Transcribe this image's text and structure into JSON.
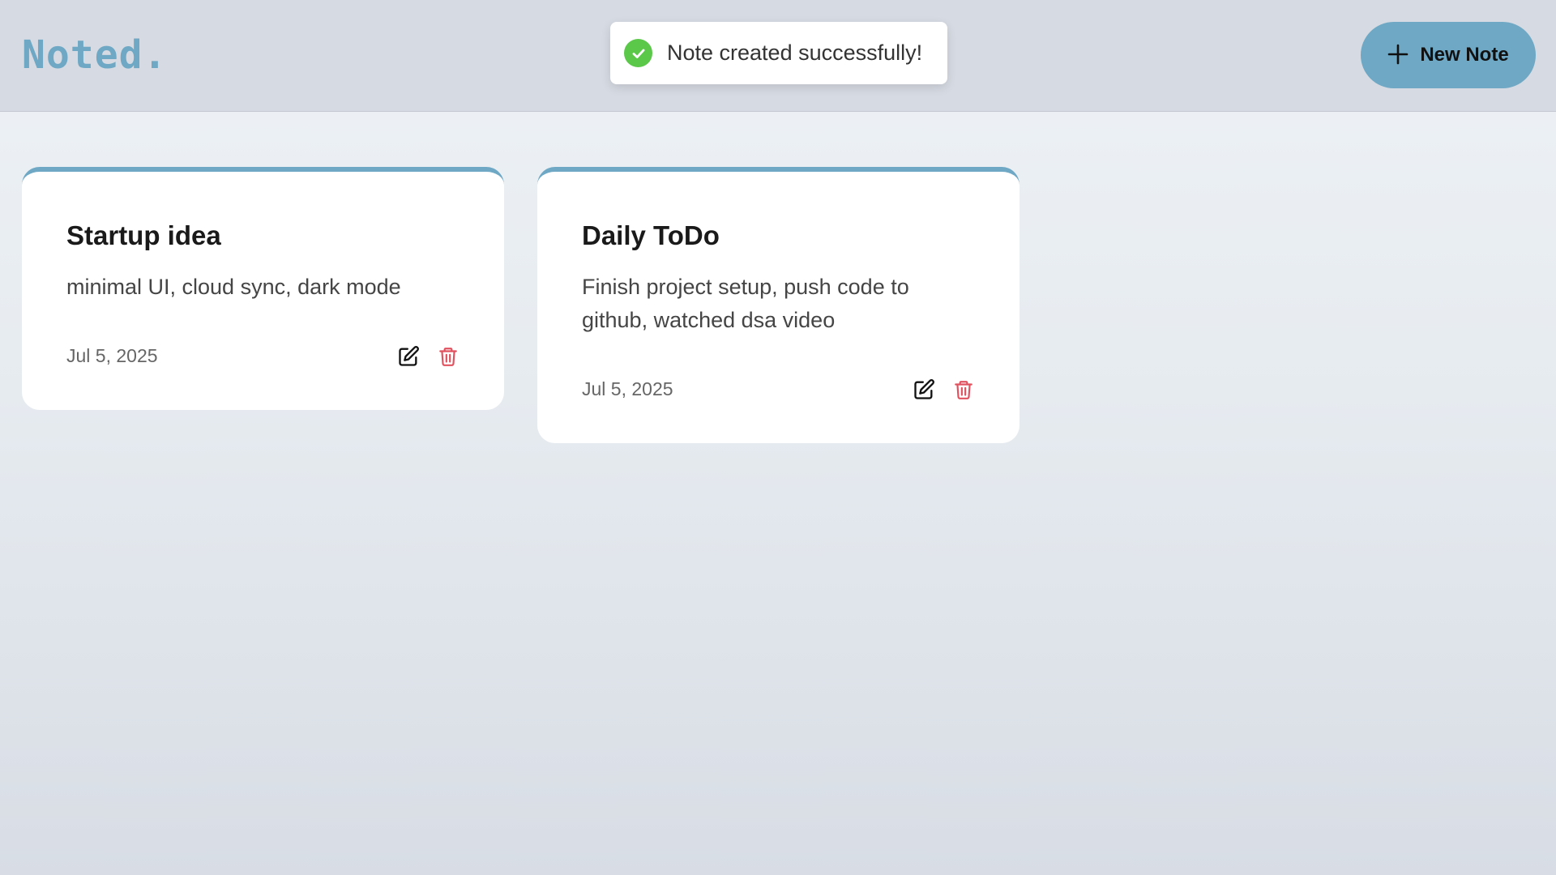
{
  "app": {
    "logo": "Noted."
  },
  "toast": {
    "message": "Note created successfully!",
    "icon": "check-circle-icon",
    "color": "#5bc84a"
  },
  "header": {
    "new_note_label": "New Note",
    "new_note_icon": "plus-icon"
  },
  "colors": {
    "accent": "#6ea8c4",
    "delete": "#e0525f"
  },
  "notes": [
    {
      "title": "Startup idea",
      "body": "minimal UI, cloud sync, dark mode",
      "date": "Jul 5, 2025"
    },
    {
      "title": "Daily ToDo",
      "body": "Finish project setup, push code to github, watched dsa video",
      "date": "Jul 5, 2025"
    }
  ]
}
